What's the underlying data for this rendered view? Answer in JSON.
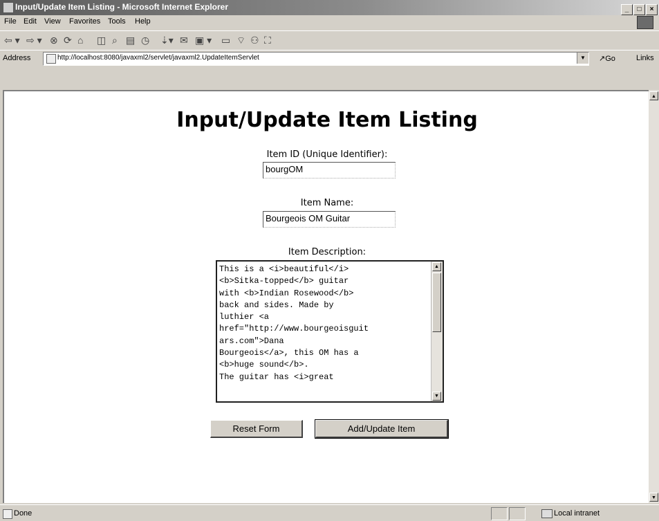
{
  "window": {
    "title": "Input/Update Item Listing - Microsoft Internet Explorer"
  },
  "menu": [
    "File",
    "Edit",
    "View",
    "Favorites",
    "Tools",
    "Help"
  ],
  "address": {
    "label": "Address",
    "url": "http://localhost:8080/javaxml2/servlet/javaxml2.UpdateItemServlet",
    "go": "Go",
    "links": "Links"
  },
  "page": {
    "title": "Input/Update Item Listing",
    "item_id": {
      "label": "Item ID (Unique Identifier):",
      "value": "bourgOM"
    },
    "item_name": {
      "label": "Item Name:",
      "value": "Bourgeois OM Guitar"
    },
    "item_description": {
      "label": "Item Description:",
      "value": "This is a <i>beautiful</i>\n<b>Sitka-topped</b> guitar\nwith <b>Indian Rosewood</b>\nback and sides. Made by\nluthier <a\nhref=\"http://www.bourgeoisguit\nars.com\">Dana\nBourgeois</a>, this OM has a\n<b>huge sound</b>.\nThe guitar has <i>great"
    },
    "reset_label": "Reset Form",
    "submit_label": "Add/Update Item"
  },
  "status": {
    "text": "Done",
    "zone": "Local intranet"
  }
}
